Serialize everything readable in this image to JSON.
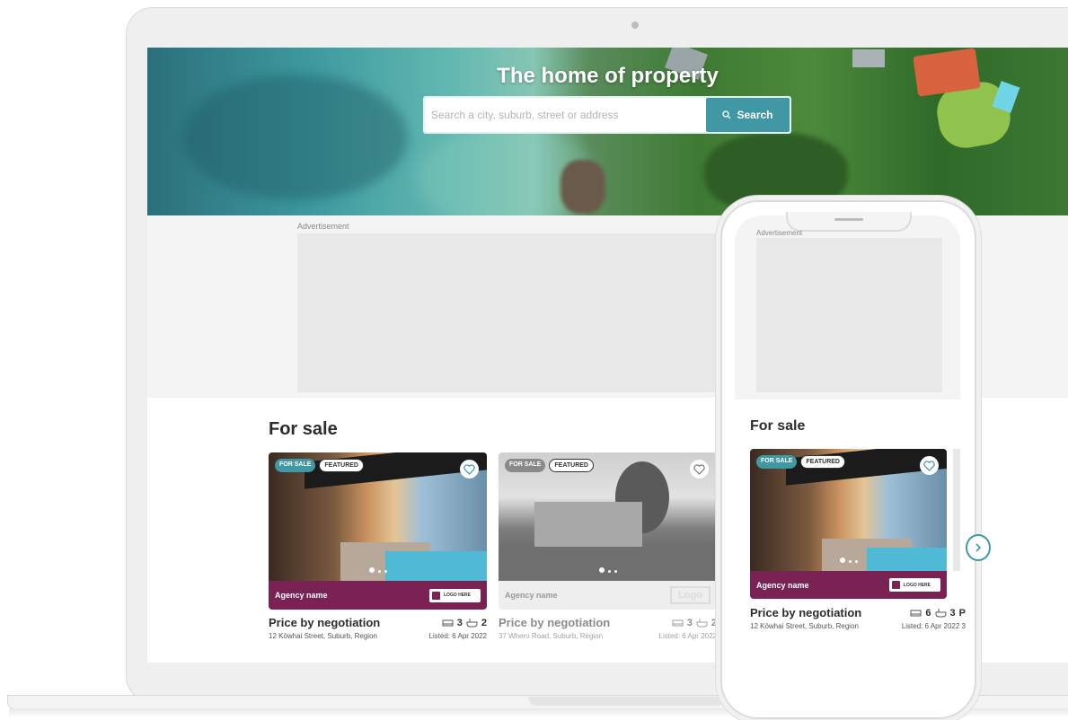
{
  "hero": {
    "title": "The home of property",
    "search_placeholder": "Search a city, suburb, street or address",
    "search_button": "Search"
  },
  "ad": {
    "label": "Advertisement"
  },
  "section": {
    "title": "For sale"
  },
  "listings": [
    {
      "badge_status": "FOR SALE",
      "badge_featured": "FEATURED",
      "agency": "Agency name",
      "logo_text": "LOGO HERE",
      "price": "Price by negotiation",
      "beds": "3",
      "baths": "2",
      "address": "12 Kōwhai Street, Suburb, Region",
      "listed": "Listed: 6 Apr 2022"
    },
    {
      "badge_status": "FOR SALE",
      "badge_featured": "FEATURED",
      "agency": "Agency name",
      "logo_text": "Logo",
      "price": "Price by negotiation",
      "beds": "3",
      "baths": "2",
      "address": "37 Whero Road, Suburb, Region",
      "listed": "Listed: 6 Apr 2022"
    }
  ],
  "mobile": {
    "ad_label": "Advertisement",
    "section_title": "For sale",
    "listing": {
      "badge_status": "FOR SALE",
      "badge_featured": "FEATURED",
      "agency": "Agency name",
      "logo_text": "LOGO HERE",
      "price": "Price by negotiation",
      "beds": "6",
      "baths": "3",
      "cut_feature": "P",
      "address": "12 Kōwhai Street, Suburb, Region",
      "listed": "Listed: 6 Apr 2022",
      "cut_meta": "3"
    }
  },
  "colors": {
    "accent": "#3f98a4",
    "agency_bar": "#7a2254"
  },
  "icons": [
    "search-icon",
    "heart-icon",
    "bed-icon",
    "bath-icon",
    "key-icon",
    "chevron-right-icon"
  ]
}
